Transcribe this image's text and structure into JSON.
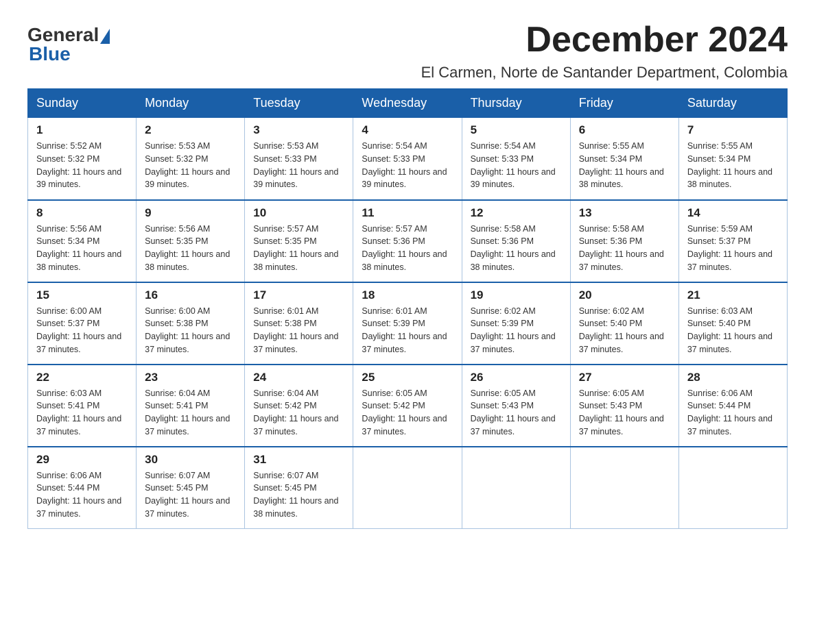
{
  "logo": {
    "general": "General",
    "blue": "Blue"
  },
  "header": {
    "month_title": "December 2024",
    "location": "El Carmen, Norte de Santander Department, Colombia"
  },
  "weekdays": [
    "Sunday",
    "Monday",
    "Tuesday",
    "Wednesday",
    "Thursday",
    "Friday",
    "Saturday"
  ],
  "weeks": [
    [
      {
        "day": "1",
        "sunrise": "5:52 AM",
        "sunset": "5:32 PM",
        "daylight": "11 hours and 39 minutes."
      },
      {
        "day": "2",
        "sunrise": "5:53 AM",
        "sunset": "5:32 PM",
        "daylight": "11 hours and 39 minutes."
      },
      {
        "day": "3",
        "sunrise": "5:53 AM",
        "sunset": "5:33 PM",
        "daylight": "11 hours and 39 minutes."
      },
      {
        "day": "4",
        "sunrise": "5:54 AM",
        "sunset": "5:33 PM",
        "daylight": "11 hours and 39 minutes."
      },
      {
        "day": "5",
        "sunrise": "5:54 AM",
        "sunset": "5:33 PM",
        "daylight": "11 hours and 39 minutes."
      },
      {
        "day": "6",
        "sunrise": "5:55 AM",
        "sunset": "5:34 PM",
        "daylight": "11 hours and 38 minutes."
      },
      {
        "day": "7",
        "sunrise": "5:55 AM",
        "sunset": "5:34 PM",
        "daylight": "11 hours and 38 minutes."
      }
    ],
    [
      {
        "day": "8",
        "sunrise": "5:56 AM",
        "sunset": "5:34 PM",
        "daylight": "11 hours and 38 minutes."
      },
      {
        "day": "9",
        "sunrise": "5:56 AM",
        "sunset": "5:35 PM",
        "daylight": "11 hours and 38 minutes."
      },
      {
        "day": "10",
        "sunrise": "5:57 AM",
        "sunset": "5:35 PM",
        "daylight": "11 hours and 38 minutes."
      },
      {
        "day": "11",
        "sunrise": "5:57 AM",
        "sunset": "5:36 PM",
        "daylight": "11 hours and 38 minutes."
      },
      {
        "day": "12",
        "sunrise": "5:58 AM",
        "sunset": "5:36 PM",
        "daylight": "11 hours and 38 minutes."
      },
      {
        "day": "13",
        "sunrise": "5:58 AM",
        "sunset": "5:36 PM",
        "daylight": "11 hours and 37 minutes."
      },
      {
        "day": "14",
        "sunrise": "5:59 AM",
        "sunset": "5:37 PM",
        "daylight": "11 hours and 37 minutes."
      }
    ],
    [
      {
        "day": "15",
        "sunrise": "6:00 AM",
        "sunset": "5:37 PM",
        "daylight": "11 hours and 37 minutes."
      },
      {
        "day": "16",
        "sunrise": "6:00 AM",
        "sunset": "5:38 PM",
        "daylight": "11 hours and 37 minutes."
      },
      {
        "day": "17",
        "sunrise": "6:01 AM",
        "sunset": "5:38 PM",
        "daylight": "11 hours and 37 minutes."
      },
      {
        "day": "18",
        "sunrise": "6:01 AM",
        "sunset": "5:39 PM",
        "daylight": "11 hours and 37 minutes."
      },
      {
        "day": "19",
        "sunrise": "6:02 AM",
        "sunset": "5:39 PM",
        "daylight": "11 hours and 37 minutes."
      },
      {
        "day": "20",
        "sunrise": "6:02 AM",
        "sunset": "5:40 PM",
        "daylight": "11 hours and 37 minutes."
      },
      {
        "day": "21",
        "sunrise": "6:03 AM",
        "sunset": "5:40 PM",
        "daylight": "11 hours and 37 minutes."
      }
    ],
    [
      {
        "day": "22",
        "sunrise": "6:03 AM",
        "sunset": "5:41 PM",
        "daylight": "11 hours and 37 minutes."
      },
      {
        "day": "23",
        "sunrise": "6:04 AM",
        "sunset": "5:41 PM",
        "daylight": "11 hours and 37 minutes."
      },
      {
        "day": "24",
        "sunrise": "6:04 AM",
        "sunset": "5:42 PM",
        "daylight": "11 hours and 37 minutes."
      },
      {
        "day": "25",
        "sunrise": "6:05 AM",
        "sunset": "5:42 PM",
        "daylight": "11 hours and 37 minutes."
      },
      {
        "day": "26",
        "sunrise": "6:05 AM",
        "sunset": "5:43 PM",
        "daylight": "11 hours and 37 minutes."
      },
      {
        "day": "27",
        "sunrise": "6:05 AM",
        "sunset": "5:43 PM",
        "daylight": "11 hours and 37 minutes."
      },
      {
        "day": "28",
        "sunrise": "6:06 AM",
        "sunset": "5:44 PM",
        "daylight": "11 hours and 37 minutes."
      }
    ],
    [
      {
        "day": "29",
        "sunrise": "6:06 AM",
        "sunset": "5:44 PM",
        "daylight": "11 hours and 37 minutes."
      },
      {
        "day": "30",
        "sunrise": "6:07 AM",
        "sunset": "5:45 PM",
        "daylight": "11 hours and 37 minutes."
      },
      {
        "day": "31",
        "sunrise": "6:07 AM",
        "sunset": "5:45 PM",
        "daylight": "11 hours and 38 minutes."
      },
      null,
      null,
      null,
      null
    ]
  ]
}
